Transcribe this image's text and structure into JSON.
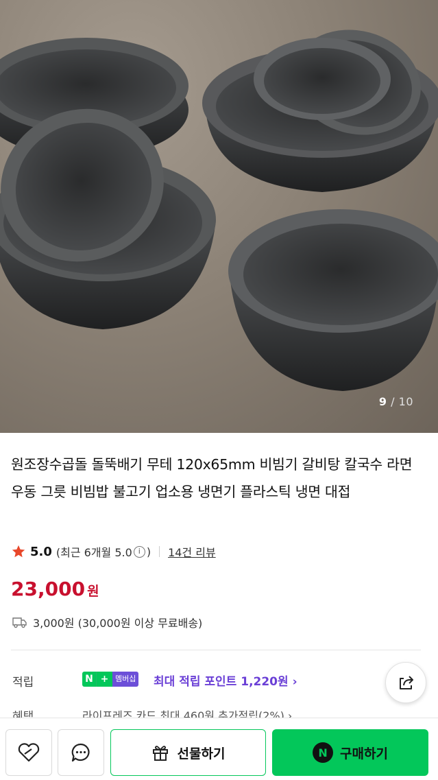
{
  "gallery": {
    "current": "9",
    "total": "10",
    "separator": "/"
  },
  "product": {
    "title": "원조장수곱돌 돌뚝배기 무테 120x65mm 비빔기 갈비탕 칼국수 라면 우동 그릇 비빔밥 불고기 업소용 냉면기 플라스틱 냉면 대접"
  },
  "rating": {
    "score": "5.0",
    "recent": "(최근 6개월 5.0",
    "recent_close": ")",
    "info_glyph": "i",
    "reviews": "14건 리뷰"
  },
  "price": {
    "value": "23,000",
    "unit": "원"
  },
  "shipping": {
    "text": "3,000원 (30,000원 이상 무료배송)"
  },
  "points": {
    "label": "적립",
    "badge_n": "N",
    "badge_plus": "+",
    "badge_member": "멤버십",
    "text": "최대 적립 포인트 1,220원 ›"
  },
  "benefit": {
    "label": "혜택",
    "text": "라이프레즈 카드 최대 460원 추가적립(2%) ›"
  },
  "bottom_bar": {
    "gift_label": "선물하기",
    "buy_label": "구매하기",
    "buy_badge": "N"
  },
  "colors": {
    "accent_green": "#03c75a",
    "price_red": "#c8102e",
    "member_purple": "#6a3fd6",
    "star": "#e8472a"
  },
  "icons": [
    "star-icon",
    "info-icon",
    "truck-icon",
    "share-icon",
    "wishlist-icon",
    "chat-icon",
    "gift-icon",
    "naver-n-icon"
  ]
}
